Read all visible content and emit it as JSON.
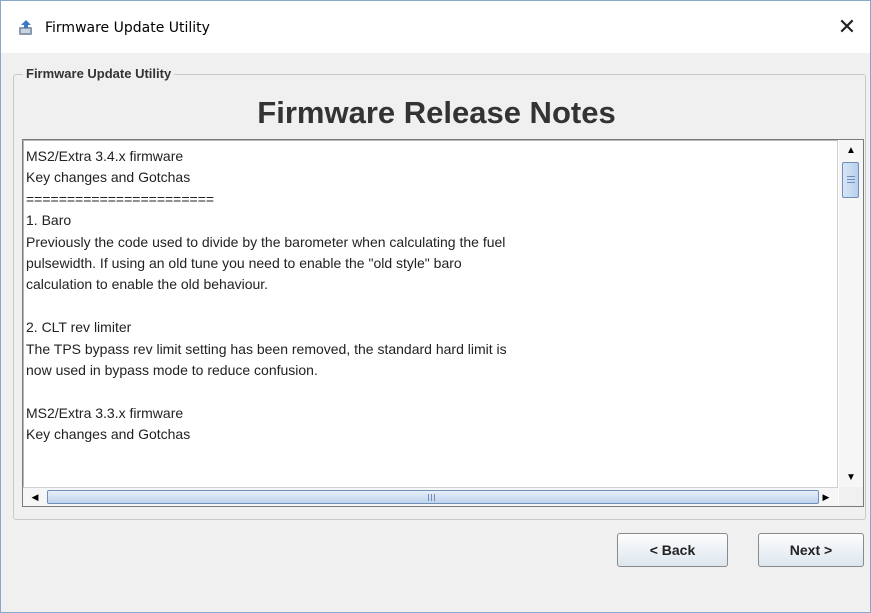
{
  "window": {
    "title": "Firmware Update Utility",
    "close_glyph": "✕"
  },
  "panel": {
    "legend": "Firmware Update Utility",
    "heading": "Firmware Release Notes"
  },
  "notes": {
    "lines": [
      "MS2/Extra 3.4.x firmware",
      "Key changes and Gotchas",
      "=======================",
      "1. Baro",
      "Previously the code used to divide by the barometer when calculating the fuel",
      "pulsewidth. If using an old tune you need to enable the \"old style\" baro",
      "calculation to enable the old behaviour.",
      "",
      "2. CLT rev limiter",
      "The TPS bypass rev limit setting has been removed, the standard hard limit is",
      "now used in bypass mode to reduce confusion.",
      "",
      "MS2/Extra 3.3.x firmware",
      "Key changes and Gotchas"
    ]
  },
  "buttons": {
    "back": "< Back",
    "next": "Next >"
  },
  "icons": {
    "app": "firmware-update-icon",
    "scroll_up": "▲",
    "scroll_down": "▼",
    "scroll_left": "◀",
    "scroll_right": "▶"
  },
  "colors": {
    "accent": "#6f8fb8",
    "window_border": "#8aa8cc",
    "background": "#f0f0f0"
  }
}
